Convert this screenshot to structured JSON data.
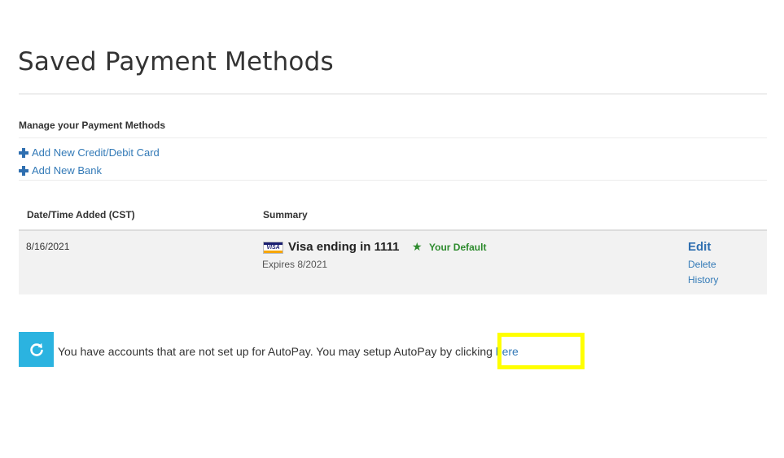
{
  "page": {
    "title": "Saved Payment Methods"
  },
  "manage": {
    "heading": "Manage your Payment Methods",
    "add_card_label": "Add New Credit/Debit Card",
    "add_bank_label": "Add New Bank"
  },
  "table": {
    "columns": [
      "Date/Time Added (CST)",
      "Summary"
    ],
    "rows": [
      {
        "date": "8/16/2021",
        "card_icon": "visa-card-icon",
        "card_icon_text": "VISA",
        "card_name": "Visa ending in 1111",
        "default_label": "Your Default",
        "expires": "Expires 8/2021",
        "actions": {
          "edit": "Edit",
          "delete": "Delete",
          "history": "History"
        }
      }
    ]
  },
  "autopay": {
    "message": "You have accounts that are not set up for AutoPay. You may setup AutoPay by clicking ",
    "link_label": "here"
  },
  "icons": {
    "add": "plus-icon",
    "default": "star-icon",
    "refresh": "refresh-icon"
  },
  "colors": {
    "link": "#337ab7",
    "default_green": "#2e8b2e",
    "refresh_bg": "#2bb3e0",
    "highlight": "#ffff00"
  }
}
